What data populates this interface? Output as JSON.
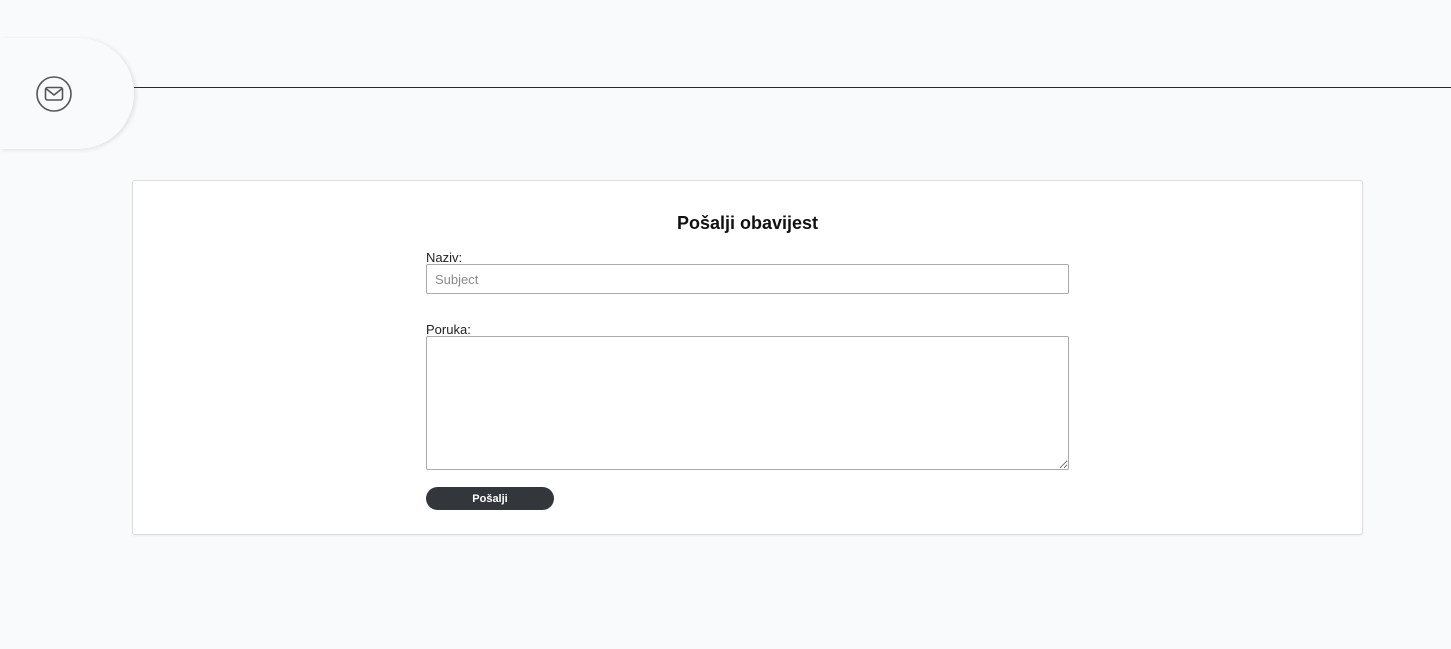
{
  "header": {
    "icon": "mail-icon"
  },
  "form": {
    "title": "Pošalji obavijest",
    "subject_label": "Naziv:",
    "subject_placeholder": "Subject",
    "subject_value": "",
    "message_label": "Poruka:",
    "message_value": "",
    "send_label": "Pošalji"
  },
  "colors": {
    "background": "#f9fafc",
    "button": "#33363b",
    "button_text": "#ffffff",
    "header_line": "#2b2b2b"
  }
}
